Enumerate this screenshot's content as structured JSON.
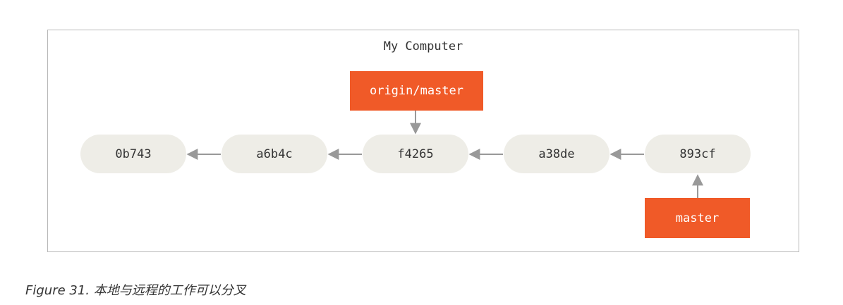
{
  "diagram": {
    "title": "My Computer",
    "commits": [
      {
        "id": "0b743"
      },
      {
        "id": "a6b4c"
      },
      {
        "id": "f4265"
      },
      {
        "id": "a38de"
      },
      {
        "id": "893cf"
      }
    ],
    "branches": {
      "origin_master": "origin/master",
      "master": "master"
    },
    "colors": {
      "branch": "#f05a28",
      "commit": "#eeede7",
      "arrow": "#999999"
    }
  },
  "caption": {
    "label": "Figure 31.",
    "text": " 本地与远程的工作可以分叉"
  }
}
